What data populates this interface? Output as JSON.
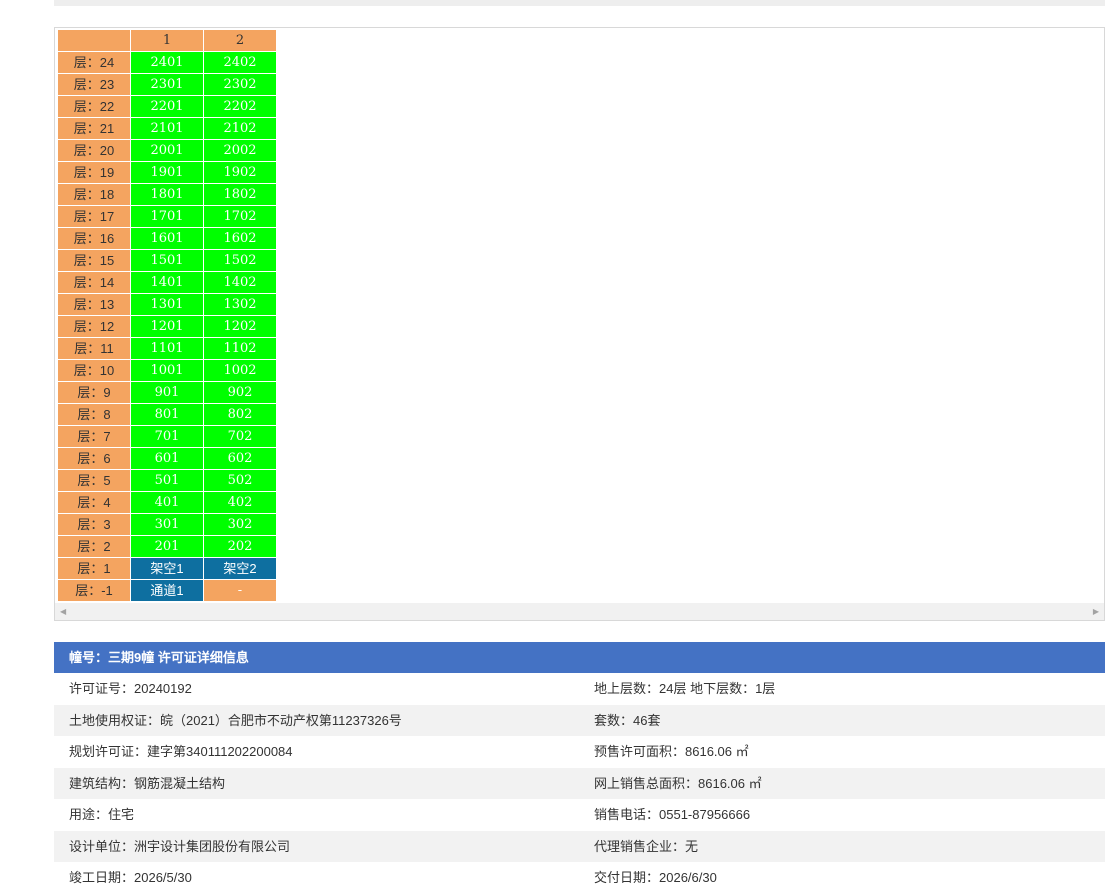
{
  "columns": [
    "",
    "1",
    "2"
  ],
  "floors": [
    {
      "label": "层：24",
      "units": [
        {
          "text": "2401",
          "status": "avail"
        },
        {
          "text": "2402",
          "status": "avail"
        }
      ]
    },
    {
      "label": "层：23",
      "units": [
        {
          "text": "2301",
          "status": "avail"
        },
        {
          "text": "2302",
          "status": "avail"
        }
      ]
    },
    {
      "label": "层：22",
      "units": [
        {
          "text": "2201",
          "status": "avail"
        },
        {
          "text": "2202",
          "status": "avail"
        }
      ]
    },
    {
      "label": "层：21",
      "units": [
        {
          "text": "2101",
          "status": "avail"
        },
        {
          "text": "2102",
          "status": "avail"
        }
      ]
    },
    {
      "label": "层：20",
      "units": [
        {
          "text": "2001",
          "status": "avail"
        },
        {
          "text": "2002",
          "status": "avail"
        }
      ]
    },
    {
      "label": "层：19",
      "units": [
        {
          "text": "1901",
          "status": "avail"
        },
        {
          "text": "1902",
          "status": "avail"
        }
      ]
    },
    {
      "label": "层：18",
      "units": [
        {
          "text": "1801",
          "status": "avail"
        },
        {
          "text": "1802",
          "status": "avail"
        }
      ]
    },
    {
      "label": "层：17",
      "units": [
        {
          "text": "1701",
          "status": "avail"
        },
        {
          "text": "1702",
          "status": "avail"
        }
      ]
    },
    {
      "label": "层：16",
      "units": [
        {
          "text": "1601",
          "status": "avail"
        },
        {
          "text": "1602",
          "status": "avail"
        }
      ]
    },
    {
      "label": "层：15",
      "units": [
        {
          "text": "1501",
          "status": "avail"
        },
        {
          "text": "1502",
          "status": "avail"
        }
      ]
    },
    {
      "label": "层：14",
      "units": [
        {
          "text": "1401",
          "status": "avail"
        },
        {
          "text": "1402",
          "status": "avail"
        }
      ]
    },
    {
      "label": "层：13",
      "units": [
        {
          "text": "1301",
          "status": "avail"
        },
        {
          "text": "1302",
          "status": "avail"
        }
      ]
    },
    {
      "label": "层：12",
      "units": [
        {
          "text": "1201",
          "status": "avail"
        },
        {
          "text": "1202",
          "status": "avail"
        }
      ]
    },
    {
      "label": "层：11",
      "units": [
        {
          "text": "1101",
          "status": "avail"
        },
        {
          "text": "1102",
          "status": "avail"
        }
      ]
    },
    {
      "label": "层：10",
      "units": [
        {
          "text": "1001",
          "status": "avail"
        },
        {
          "text": "1002",
          "status": "avail"
        }
      ]
    },
    {
      "label": "层：9",
      "units": [
        {
          "text": "901",
          "status": "avail"
        },
        {
          "text": "902",
          "status": "avail"
        }
      ]
    },
    {
      "label": "层：8",
      "units": [
        {
          "text": "801",
          "status": "avail"
        },
        {
          "text": "802",
          "status": "avail"
        }
      ]
    },
    {
      "label": "层：7",
      "units": [
        {
          "text": "701",
          "status": "avail"
        },
        {
          "text": "702",
          "status": "avail"
        }
      ]
    },
    {
      "label": "层：6",
      "units": [
        {
          "text": "601",
          "status": "avail"
        },
        {
          "text": "602",
          "status": "avail"
        }
      ]
    },
    {
      "label": "层：5",
      "units": [
        {
          "text": "501",
          "status": "avail"
        },
        {
          "text": "502",
          "status": "avail"
        }
      ]
    },
    {
      "label": "层：4",
      "units": [
        {
          "text": "401",
          "status": "avail"
        },
        {
          "text": "402",
          "status": "avail"
        }
      ]
    },
    {
      "label": "层：3",
      "units": [
        {
          "text": "301",
          "status": "avail"
        },
        {
          "text": "302",
          "status": "avail"
        }
      ]
    },
    {
      "label": "层：2",
      "units": [
        {
          "text": "201",
          "status": "avail"
        },
        {
          "text": "202",
          "status": "avail"
        }
      ]
    },
    {
      "label": "层：1",
      "units": [
        {
          "text": "架空1",
          "status": "blue"
        },
        {
          "text": "架空2",
          "status": "blue"
        }
      ]
    },
    {
      "label": "层：-1",
      "units": [
        {
          "text": "通道1",
          "status": "blue"
        },
        {
          "text": "-",
          "status": "none"
        }
      ]
    }
  ],
  "colors": {
    "header_orange": "#f4a460",
    "available_green": "#00ff00",
    "special_blue": "#0e6fa0",
    "info_header_blue": "#4472c4"
  },
  "scrollbar": {
    "left_icon": "◀",
    "right_icon": "▶"
  },
  "info": {
    "title": "幢号：三期9幢 许可证详细信息",
    "rows": [
      {
        "left": "许可证号：20240192",
        "right": "地上层数：24层  地下层数：1层"
      },
      {
        "left": "土地使用权证：皖（2021）合肥市不动产权第11237326号",
        "right": "套数：46套"
      },
      {
        "left": "规划许可证：建字第340111202200084",
        "right": "预售许可面积：8616.06 ㎡"
      },
      {
        "left": "建筑结构：钢筋混凝土结构",
        "right": "网上销售总面积：8616.06 ㎡"
      },
      {
        "left": "用途：住宅",
        "right": "销售电话：0551-87956666"
      },
      {
        "left": "设计单位：洲宇设计集团股份有限公司",
        "right": "代理销售企业：无"
      },
      {
        "left": "竣工日期：2026/5/30",
        "right": "交付日期：2026/6/30"
      }
    ]
  }
}
